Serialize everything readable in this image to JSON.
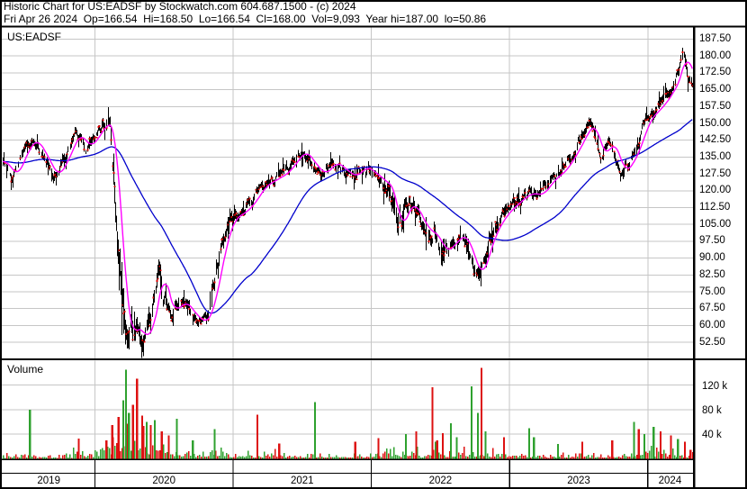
{
  "header": {
    "line1": "Historic Chart for US:EADSF by Stockwatch.com 604.687.1500 - (c) 2024",
    "line2": "Fri Apr 26 2024  Op=166.54  Hi=168.50  Lo=166.54  Cl=168.00  Vol=9,093  Year hi=187.00  lo=50.86"
  },
  "quote": {
    "date": "Fri Apr 26 2024",
    "open": "166.54",
    "high": "168.50",
    "low": "166.54",
    "close": "168.00",
    "volume": "9,093",
    "year_high": "187.00",
    "year_low": "50.86"
  },
  "price_pane": {
    "symbol": "US:EADSF"
  },
  "volume_pane": {
    "label": "Volume"
  },
  "chart_data": {
    "type": "candlestick",
    "title": "Historic Chart for US:EADSF",
    "symbol": "US:EADSF",
    "x_axis": {
      "years": [
        "2019",
        "2020",
        "2021",
        "2022",
        "2023",
        "2024"
      ],
      "start_month": "2019-05",
      "end_month": "2024-04"
    },
    "y_axis": {
      "unit": "USD",
      "ticks": [
        187.5,
        180,
        172.5,
        165,
        157.5,
        150,
        142.5,
        135,
        127.5,
        120,
        112.5,
        105,
        97.5,
        90,
        82.5,
        75,
        67.5,
        60,
        52.5
      ]
    },
    "volume_axis": {
      "ticks": [
        {
          "label": "120 k",
          "value": 120
        },
        {
          "label": "80 k",
          "value": 80
        },
        {
          "label": "40 k",
          "value": 40
        }
      ]
    },
    "price_series_monthly": [
      [
        0,
        133,
        4
      ],
      [
        0.8,
        126,
        4
      ],
      [
        2,
        140,
        4
      ],
      [
        2.6,
        143,
        4
      ],
      [
        3.4,
        136,
        4
      ],
      [
        4.4,
        126,
        4
      ],
      [
        5.2,
        133,
        4
      ],
      [
        6.3,
        146,
        4
      ],
      [
        7.2,
        139,
        4
      ],
      [
        8.2,
        146,
        4
      ],
      [
        8.8,
        151,
        5
      ],
      [
        9.3,
        148,
        6
      ],
      [
        9.8,
        112,
        13
      ],
      [
        10.3,
        72,
        14
      ],
      [
        10.8,
        54,
        12
      ],
      [
        11.4,
        61,
        8
      ],
      [
        12.1,
        53,
        7
      ],
      [
        12.8,
        62,
        6
      ],
      [
        13.3,
        76,
        7
      ],
      [
        13.55,
        90,
        9
      ],
      [
        13.9,
        73,
        6
      ],
      [
        14.6,
        66,
        5
      ],
      [
        15.5,
        71,
        5
      ],
      [
        16.5,
        64,
        4
      ],
      [
        17.3,
        61,
        4
      ],
      [
        17.8,
        66,
        5
      ],
      [
        18.4,
        80,
        6
      ],
      [
        19.1,
        99,
        6
      ],
      [
        19.8,
        108,
        5
      ],
      [
        20.6,
        110,
        4
      ],
      [
        21.4,
        114,
        4
      ],
      [
        22.4,
        122,
        4
      ],
      [
        23.4,
        125,
        4
      ],
      [
        24.4,
        128,
        4
      ],
      [
        25.3,
        134,
        4
      ],
      [
        25.9,
        138,
        4
      ],
      [
        26.9,
        131,
        4
      ],
      [
        27.6,
        127,
        4
      ],
      [
        28.6,
        133,
        4
      ],
      [
        29.5,
        129,
        4
      ],
      [
        30.3,
        126,
        4
      ],
      [
        31.2,
        131,
        5
      ],
      [
        32.2,
        127,
        5
      ],
      [
        33.6,
        121,
        6
      ],
      [
        34.2,
        101,
        13
      ],
      [
        34.8,
        112,
        7
      ],
      [
        35.5,
        114,
        5
      ],
      [
        36.5,
        103,
        6
      ],
      [
        37.5,
        100,
        6
      ],
      [
        38.1,
        92,
        6
      ],
      [
        38.8,
        96,
        5
      ],
      [
        39.8,
        101,
        5
      ],
      [
        40.6,
        90,
        6
      ],
      [
        41.2,
        81,
        6
      ],
      [
        42.3,
        100,
        6
      ],
      [
        43.3,
        109,
        5
      ],
      [
        44.5,
        115,
        5
      ],
      [
        45.5,
        119,
        4
      ],
      [
        46.5,
        118,
        4
      ],
      [
        47.5,
        125,
        4
      ],
      [
        48.5,
        129,
        4
      ],
      [
        49.5,
        137,
        4
      ],
      [
        50.6,
        148,
        4
      ],
      [
        51,
        150,
        4
      ],
      [
        51.9,
        134,
        5
      ],
      [
        52.6,
        143,
        4
      ],
      [
        53.6,
        128,
        5
      ],
      [
        54.3,
        132,
        4
      ],
      [
        55,
        140,
        4
      ],
      [
        55.7,
        151,
        4
      ],
      [
        56.4,
        155,
        4
      ],
      [
        57,
        158,
        4
      ],
      [
        57.8,
        164,
        4
      ],
      [
        58.5,
        171,
        5
      ],
      [
        58.95,
        184,
        5
      ],
      [
        59.2,
        177,
        5
      ],
      [
        59.55,
        170,
        4
      ],
      [
        59.85,
        168,
        3
      ]
    ],
    "ma_short_days": 21,
    "ma_long_days": 165,
    "volume_base_k": [
      [
        0,
        6
      ],
      [
        2,
        9
      ],
      [
        4,
        5
      ],
      [
        6,
        7
      ],
      [
        8,
        9
      ],
      [
        9,
        20
      ],
      [
        10,
        42
      ],
      [
        11,
        45
      ],
      [
        12,
        34
      ],
      [
        13,
        28
      ],
      [
        14,
        20
      ],
      [
        15,
        13
      ],
      [
        16,
        9
      ],
      [
        17,
        9
      ],
      [
        18,
        13
      ],
      [
        19,
        11
      ],
      [
        20,
        8
      ],
      [
        22,
        7
      ],
      [
        24,
        7
      ],
      [
        26,
        8
      ],
      [
        28,
        6
      ],
      [
        30,
        7
      ],
      [
        32,
        9
      ],
      [
        34,
        13
      ],
      [
        35,
        10
      ],
      [
        36,
        8
      ],
      [
        38,
        11
      ],
      [
        40,
        12
      ],
      [
        42,
        12
      ],
      [
        44,
        9
      ],
      [
        46,
        7
      ],
      [
        48,
        6
      ],
      [
        50,
        7
      ],
      [
        52,
        8
      ],
      [
        54,
        9
      ],
      [
        55,
        11
      ],
      [
        56,
        16
      ],
      [
        57,
        14
      ],
      [
        58,
        11
      ],
      [
        59,
        9
      ],
      [
        59.9,
        7
      ]
    ],
    "volume_spikes_k": [
      [
        2.35,
        80,
        "g"
      ],
      [
        6.6,
        33,
        "r"
      ],
      [
        9.0,
        30,
        "r"
      ],
      [
        9.5,
        55,
        "r"
      ],
      [
        10.05,
        68,
        "r"
      ],
      [
        10.45,
        95,
        "g"
      ],
      [
        10.7,
        145,
        "g"
      ],
      [
        10.95,
        75,
        "g"
      ],
      [
        11.3,
        88,
        "r"
      ],
      [
        11.65,
        130,
        "r"
      ],
      [
        12.1,
        70,
        "r"
      ],
      [
        12.5,
        60,
        "g"
      ],
      [
        12.85,
        55,
        "r"
      ],
      [
        13.2,
        63,
        "g"
      ],
      [
        13.8,
        45,
        "r"
      ],
      [
        14.4,
        38,
        "r"
      ],
      [
        15.1,
        65,
        "g"
      ],
      [
        16.5,
        30,
        "g"
      ],
      [
        18.4,
        48,
        "g"
      ],
      [
        22.1,
        72,
        "r"
      ],
      [
        24,
        25,
        "r"
      ],
      [
        27.1,
        92,
        "g"
      ],
      [
        30.6,
        28,
        "r"
      ],
      [
        32.6,
        34,
        "r"
      ],
      [
        35,
        40,
        "g"
      ],
      [
        35.9,
        45,
        "r"
      ],
      [
        37.3,
        116,
        "r"
      ],
      [
        37.7,
        30,
        "r"
      ],
      [
        38.2,
        42,
        "r"
      ],
      [
        38.9,
        58,
        "g"
      ],
      [
        39.4,
        35,
        "g"
      ],
      [
        40.7,
        118,
        "g"
      ],
      [
        41.25,
        75,
        "g"
      ],
      [
        41.56,
        148,
        "r"
      ],
      [
        41.9,
        45,
        "g"
      ],
      [
        43.5,
        35,
        "r"
      ],
      [
        45.7,
        50,
        "g"
      ],
      [
        46.1,
        35,
        "g"
      ],
      [
        48.2,
        24,
        "g"
      ],
      [
        50.3,
        28,
        "r"
      ],
      [
        52.9,
        30,
        "r"
      ],
      [
        54.8,
        60,
        "g"
      ],
      [
        55.2,
        48,
        "r"
      ],
      [
        55.7,
        40,
        "g"
      ],
      [
        56.5,
        52,
        "g"
      ],
      [
        57.1,
        45,
        "r"
      ],
      [
        58,
        38,
        "r"
      ],
      [
        58.6,
        32,
        "g"
      ],
      [
        59.2,
        28,
        "r"
      ],
      [
        59.7,
        15,
        "r"
      ]
    ],
    "colors": {
      "candle": "#000000",
      "close_tick": "#dd0000",
      "ma_short": "#ff00ff",
      "ma_long": "#0000cc",
      "vol_up": "#2fa12f",
      "vol_down": "#dd1111",
      "grid": "#c6c6c6",
      "frame": "#000000"
    },
    "texture_seed": 11
  }
}
